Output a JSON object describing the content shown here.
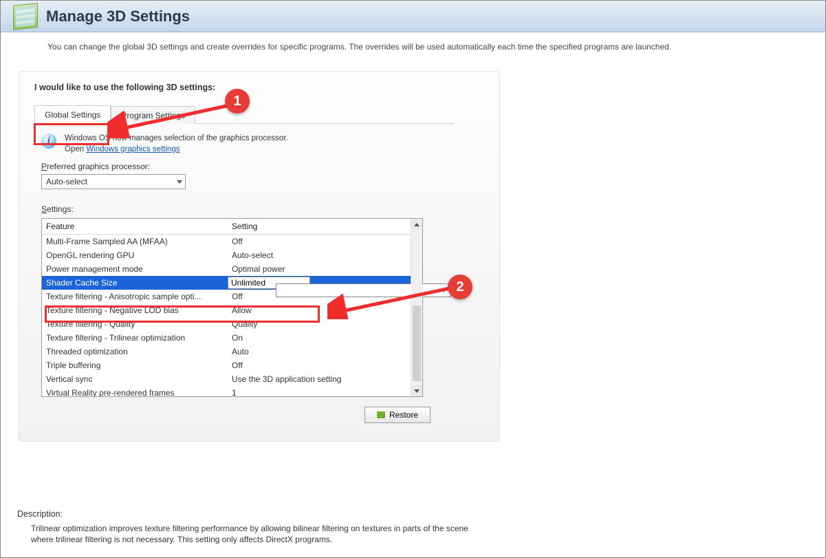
{
  "header": {
    "title": "Manage 3D Settings"
  },
  "intro": "You can change the global 3D settings and create overrides for specific programs. The overrides will be used automatically each time the specified programs are launched.",
  "section_title": "I would like to use the following 3D settings:",
  "tabs": {
    "global": "Global Settings",
    "program": "Program Settings"
  },
  "info": {
    "line1": "Windows OS now manages selection of the graphics processor.",
    "line2_prefix": "Open ",
    "link": "Windows graphics settings"
  },
  "preferred_label": "Preferred graphics processor:",
  "preferred_value": "Auto-select",
  "settings_label": "Settings:",
  "columns": {
    "feature": "Feature",
    "setting": "Setting"
  },
  "rows": [
    {
      "feature": "Multi-Frame Sampled AA (MFAA)",
      "setting": "Off"
    },
    {
      "feature": "OpenGL rendering GPU",
      "setting": "Auto-select"
    },
    {
      "feature": "Power management mode",
      "setting": "Optimal power"
    },
    {
      "feature": "Shader Cache Size",
      "setting": "Unlimited",
      "selected": true
    },
    {
      "feature": "Texture filtering - Anisotropic sample opti...",
      "setting": "Off"
    },
    {
      "feature": "Texture filtering - Negative LOD bias",
      "setting": "Allow"
    },
    {
      "feature": "Texture filtering - Quality",
      "setting": "Quality"
    },
    {
      "feature": "Texture filtering - Trilinear optimization",
      "setting": "On"
    },
    {
      "feature": "Threaded optimization",
      "setting": "Auto"
    },
    {
      "feature": "Triple buffering",
      "setting": "Off"
    },
    {
      "feature": "Vertical sync",
      "setting": "Use the 3D application setting"
    },
    {
      "feature": "Virtual Reality pre-rendered frames",
      "setting": "1"
    }
  ],
  "restore_label": "Restore",
  "description": {
    "title": "Description:",
    "text": "Trilinear optimization improves texture filtering performance by allowing bilinear filtering on textures in parts of the scene where trilinear filtering is not necessary. This setting only affects DirectX programs."
  },
  "callouts": {
    "one": "1",
    "two": "2"
  }
}
